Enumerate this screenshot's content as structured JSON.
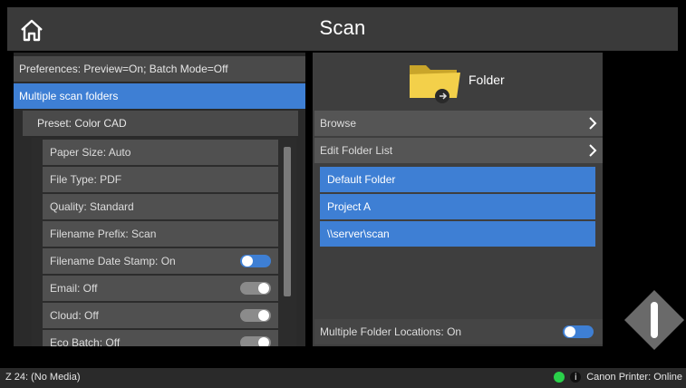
{
  "header": {
    "title": "Scan",
    "home_icon": "home-icon"
  },
  "left": {
    "preferences_label": "Preferences: Preview=On; Batch Mode=Off",
    "multiple_scan_folders_label": "Multiple scan folders",
    "preset_label": "Preset: Color CAD",
    "settings": [
      {
        "label": "Paper Size: Auto"
      },
      {
        "label": "File Type: PDF"
      },
      {
        "label": "Quality: Standard"
      },
      {
        "label": "Filename Prefix: Scan"
      },
      {
        "label": "Filename Date Stamp: On",
        "toggle": "on"
      },
      {
        "label": "Email: Off",
        "toggle": "off"
      },
      {
        "label": "Cloud: Off",
        "toggle": "off"
      },
      {
        "label": "Eco Batch: Off",
        "toggle": "off"
      }
    ]
  },
  "right": {
    "folder_title": "Folder",
    "browse_label": "Browse",
    "edit_folder_list_label": "Edit Folder List",
    "folders": [
      "Default Folder",
      "Project A",
      "\\\\server\\scan"
    ],
    "multiple_folder_locations_label": "Multiple Folder Locations: On",
    "multiple_folder_locations_toggle": "on"
  },
  "status": {
    "left_text": "Z 24: (No Media)",
    "right_text": "Canon Printer: Online",
    "led_color": "#2ad14a"
  },
  "colors": {
    "accent": "#3e7fd4",
    "background": "#000000",
    "panel": "#3a3a3a"
  }
}
